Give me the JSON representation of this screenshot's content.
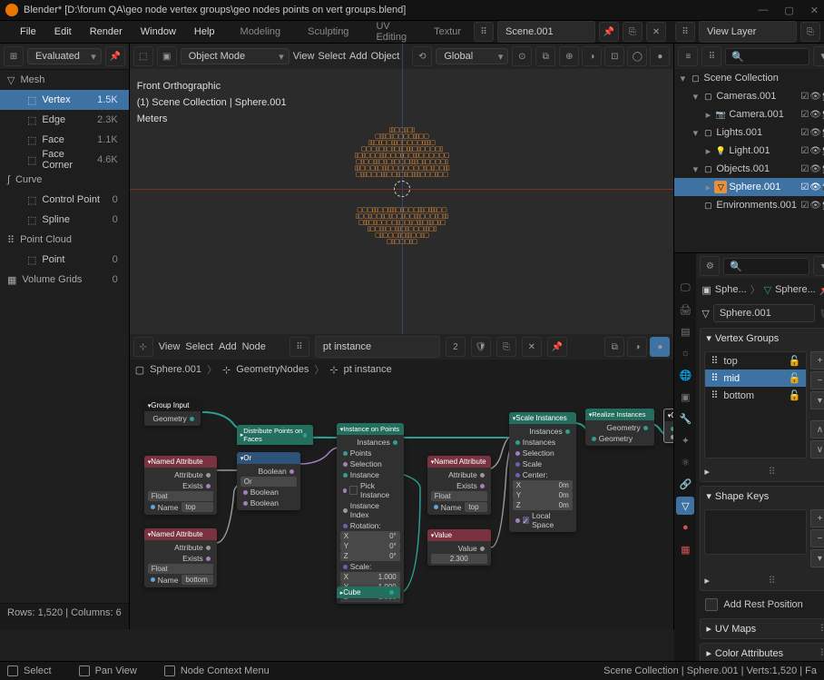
{
  "title": "Blender* [D:\\forum QA\\geo node vertex groups\\geo nodes points on vert groups.blend]",
  "topmenu": [
    "File",
    "Edit",
    "Render",
    "Window",
    "Help"
  ],
  "tabs": [
    "Modeling",
    "Sculpting",
    "UV Editing",
    "Textur"
  ],
  "scene": "Scene.001",
  "viewlayer": "View Layer",
  "spreadsheet": {
    "mode": "Evaluated",
    "groups": [
      {
        "label": "Mesh",
        "icon": "▽",
        "items": [
          {
            "label": "Vertex",
            "count": "1.5K",
            "sel": true
          },
          {
            "label": "Edge",
            "count": "2.3K"
          },
          {
            "label": "Face",
            "count": "1.1K"
          },
          {
            "label": "Face Corner",
            "count": "4.6K"
          }
        ]
      },
      {
        "label": "Curve",
        "icon": "∫",
        "items": [
          {
            "label": "Control Point",
            "count": "0"
          },
          {
            "label": "Spline",
            "count": "0"
          }
        ]
      },
      {
        "label": "Point Cloud",
        "icon": "⠿",
        "items": [
          {
            "label": "Point",
            "count": "0"
          }
        ]
      },
      {
        "label": "Volume Grids",
        "icon": "▦",
        "items": [],
        "count": "0"
      }
    ],
    "footer": "Rows: 1,520   |   Columns: 6"
  },
  "viewport": {
    "mode": "Object Mode",
    "menus": [
      "View",
      "Select",
      "Add",
      "Object"
    ],
    "orient": "Global",
    "overlay": [
      "Front Orthographic",
      "(1) Scene Collection | Sphere.001",
      "Meters"
    ]
  },
  "nodeeditor": {
    "menus": [
      "View",
      "Select",
      "Add",
      "Node"
    ],
    "treename": "pt instance",
    "users": "2",
    "path": [
      "Sphere.001",
      "GeometryNodes",
      "pt instance"
    ],
    "nodes": {
      "groupin": {
        "title": "Group Input",
        "out": "Geometry"
      },
      "named1": {
        "title": "Named Attribute",
        "out": "Attribute",
        "exists": "Exists",
        "type": "Float",
        "name": "Name",
        "val": "top"
      },
      "named2": {
        "title": "Named Attribute",
        "out": "Attribute",
        "exists": "Exists",
        "type": "Float",
        "name": "Name",
        "val": "bottom"
      },
      "named3": {
        "title": "Named Attribute",
        "out": "Attribute",
        "exists": "Exists",
        "type": "Float",
        "name": "Name",
        "val": "top"
      },
      "or": {
        "title": "Or",
        "out": "Boolean",
        "mode": "Or",
        "in1": "Boolean",
        "in2": "Boolean"
      },
      "dist": {
        "title": "Distribute Points on Faces"
      },
      "inst": {
        "title": "Instance on Points",
        "out": "Instances",
        "points": "Points",
        "sel": "Selection",
        "instin": "Instance",
        "pick": "Pick Instance",
        "idx": "Instance Index",
        "rot": "Rotation:",
        "scale": "Scale:",
        "x": "X",
        "y": "Y",
        "z": "Z",
        "zero": "0°",
        "one": "1.000"
      },
      "cube": {
        "title": "Cube"
      },
      "value": {
        "title": "Value",
        "out": "Value",
        "val": "2.300"
      },
      "scalei": {
        "title": "Scale Instances",
        "out": "Instances",
        "inst": "Instances",
        "sel": "Selection",
        "scale": "Scale",
        "center": "Center:",
        "x": "X",
        "y": "Y",
        "z": "Z",
        "zero": "0m",
        "local": "Local Space"
      },
      "realize": {
        "title": "Realize Instances",
        "out": "Geometry",
        "in": "Geometry"
      },
      "groupout": {
        "title": "Group Output",
        "in": "Geometry"
      }
    }
  },
  "outliner": {
    "root": "Scene Collection",
    "items": [
      {
        "indent": 1,
        "exp": "▾",
        "icon": "coll",
        "label": "Cameras.001",
        "ctl": true
      },
      {
        "indent": 2,
        "exp": "▸",
        "icon": "cam",
        "label": "Camera.001",
        "ctl": true
      },
      {
        "indent": 1,
        "exp": "▾",
        "icon": "coll",
        "label": "Lights.001",
        "ctl": true
      },
      {
        "indent": 2,
        "exp": "▸",
        "icon": "light",
        "label": "Light.001",
        "ctl": true
      },
      {
        "indent": 1,
        "exp": "▾",
        "icon": "coll",
        "label": "Objects.001",
        "ctl": true
      },
      {
        "indent": 2,
        "exp": "▸",
        "icon": "obj-sel",
        "label": "Sphere.001",
        "ctl": true,
        "sel": true
      },
      {
        "indent": 1,
        "exp": "",
        "icon": "coll",
        "label": "Environments.001",
        "ctl": true
      }
    ]
  },
  "props": {
    "crumb": [
      "Sphe...",
      "Sphere..."
    ],
    "objname": "Sphere.001",
    "panels": {
      "vg": {
        "title": "Vertex Groups",
        "items": [
          {
            "name": "top"
          },
          {
            "name": "mid",
            "sel": true
          },
          {
            "name": "bottom"
          }
        ]
      },
      "sk": {
        "title": "Shape Keys"
      },
      "rest": "Add Rest Position",
      "uv": {
        "title": "UV Maps"
      },
      "ca": {
        "title": "Color Attributes"
      }
    }
  },
  "status": {
    "select": "Select",
    "pan": "Pan View",
    "ctx": "Node Context Menu",
    "right": "Scene Collection | Sphere.001 | Verts:1,520 | Fa"
  }
}
